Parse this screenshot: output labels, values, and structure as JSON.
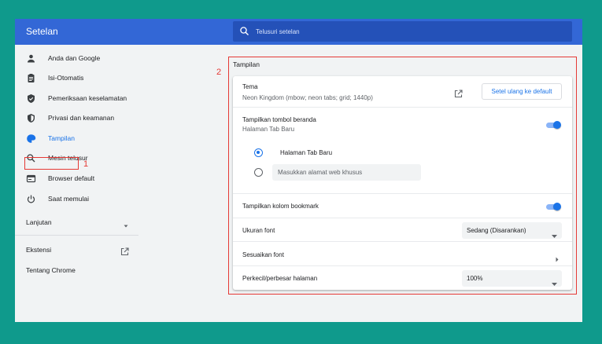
{
  "header": {
    "title": "Setelan",
    "search_placeholder": "Telusuri setelan",
    "bg_color": "#3367d6"
  },
  "sidebar": {
    "items": [
      {
        "label": "Anda dan Google",
        "icon": "person-icon"
      },
      {
        "label": "Isi-Otomatis",
        "icon": "clipboard-icon"
      },
      {
        "label": "Pemeriksaan keselamatan",
        "icon": "shield-check-icon"
      },
      {
        "label": "Privasi dan keamanan",
        "icon": "shield-lock-icon"
      },
      {
        "label": "Tampilan",
        "icon": "palette-icon",
        "active": true
      },
      {
        "label": "Mesin telusur",
        "icon": "search-icon"
      },
      {
        "label": "Browser default",
        "icon": "browser-icon"
      },
      {
        "label": "Saat memulai",
        "icon": "power-icon"
      }
    ],
    "advanced_label": "Lanjutan",
    "extensions_label": "Ekstensi",
    "about_label": "Tentang Chrome"
  },
  "annotations": {
    "marker_1": "1",
    "marker_2": "2",
    "color": "#e53935"
  },
  "appearance": {
    "section_title": "Tampilan",
    "theme": {
      "label": "Tema",
      "value": "Neon Kingdom (mbow; neon tabs; grid; 1440p)",
      "reset_button": "Setel ulang ke default"
    },
    "home_button": {
      "label": "Tampilkan tombol beranda",
      "value": "Halaman Tab Baru",
      "enabled": true,
      "options": [
        {
          "label": "Halaman Tab Baru",
          "selected": true
        },
        {
          "placeholder": "Masukkan alamat web khusus",
          "selected": false
        }
      ]
    },
    "bookmarks_bar": {
      "label": "Tampilkan kolom bookmark",
      "enabled": true
    },
    "font_size": {
      "label": "Ukuran font",
      "value": "Sedang (Disarankan)"
    },
    "customize_fonts": {
      "label": "Sesuaikan font"
    },
    "page_zoom": {
      "label": "Perkecil/perbesar halaman",
      "value": "100%"
    }
  },
  "colors": {
    "accent": "#1a73e8",
    "background": "#0f9a8c"
  }
}
